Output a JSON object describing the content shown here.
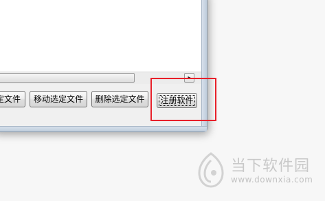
{
  "window": {
    "buttons": {
      "partial_label": "定文件",
      "move_label": "移动选定文件",
      "delete_label": "删除选定文件",
      "register_label": "注册软件"
    },
    "scroll_arrow": "▸"
  },
  "highlight": {
    "color": "#e8202a"
  },
  "watermark": {
    "brand": "当下软件园",
    "url": "www.downxia.com"
  }
}
